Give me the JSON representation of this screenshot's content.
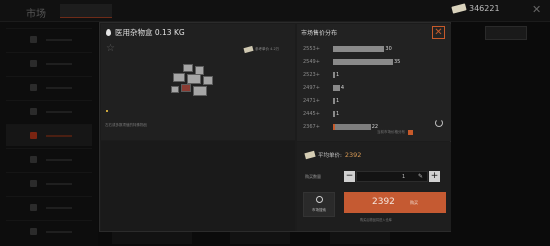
{
  "app": {
    "title": "市场",
    "currency_value": "346221"
  },
  "item": {
    "name": "医用杂物盒 0.13 KG",
    "reference_text": "参考单价 4.2万",
    "description": "左右或多数项值的特殊物品",
    "colors": {
      "accent": "#c55a32",
      "price": "#d99a55"
    }
  },
  "market": {
    "title": "市场售价分布",
    "legend_text": "当前市场价格分布"
  },
  "chart_data": {
    "type": "bar",
    "orientation": "horizontal",
    "categories": [
      "2553+",
      "2549+",
      "2523+",
      "2497+",
      "2471+",
      "2445+",
      "2367+"
    ],
    "values": [
      30,
      35,
      1,
      4,
      1,
      1,
      22
    ],
    "current_price_category": "2367+"
  },
  "buy": {
    "avg_label": "平均单价:",
    "avg_value": "2392",
    "qty_label": "购买数量",
    "qty_value": "1",
    "search_label": "市场搜索",
    "buy_price": "2392",
    "buy_label": "购买",
    "hint": "购买后物品将进入仓库"
  }
}
